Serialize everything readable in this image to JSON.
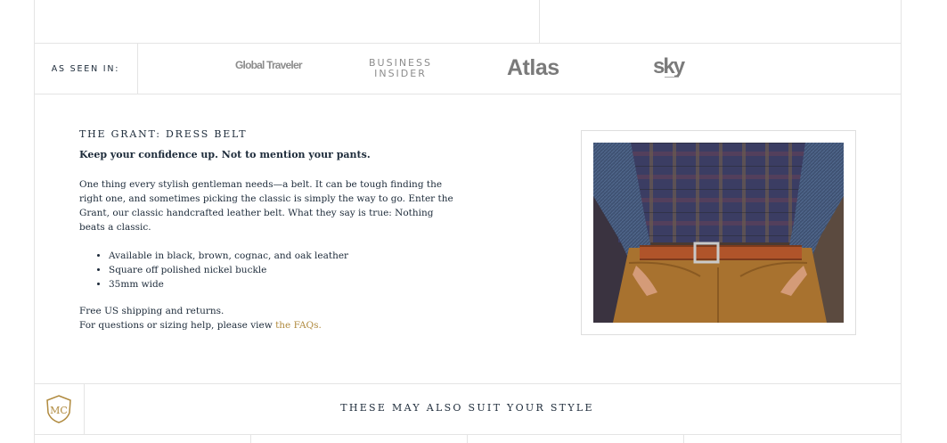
{
  "press": {
    "label": "AS SEEN IN:",
    "logos": [
      {
        "name": "Global Traveler",
        "text": "Global Traveler"
      },
      {
        "name": "Business Insider",
        "line1": "BUSINESS",
        "line2": "INSIDER"
      },
      {
        "name": "Atlas",
        "text": "Atlas"
      },
      {
        "name": "Sky",
        "text": "sky"
      }
    ]
  },
  "product": {
    "title": "THE GRANT: DRESS BELT",
    "tagline": "Keep your confidence up. Not to mention your pants.",
    "description": "One thing every stylish gentleman needs—a belt. It can be tough finding the right one, and sometimes picking the classic is simply the way to go. Enter the Grant, our classic handcrafted leather belt. What they say is true: Nothing beats a classic.",
    "features": [
      "Available in black, brown, cognac, and oak leather",
      "Square off polished nickel buckle",
      "35mm wide"
    ],
    "shipping": "Free US shipping and returns.",
    "help_prefix": "For questions or sizing help, please view ",
    "faq_link": "the FAQs."
  },
  "footer": {
    "suggestions_heading": "THESE MAY ALSO SUIT YOUR STYLE",
    "crest_letters": "MC"
  },
  "colors": {
    "text": "#1d2b3a",
    "link": "#b08a3e",
    "border": "#e4e4e4",
    "logo_gray": "#8c8c8c"
  }
}
